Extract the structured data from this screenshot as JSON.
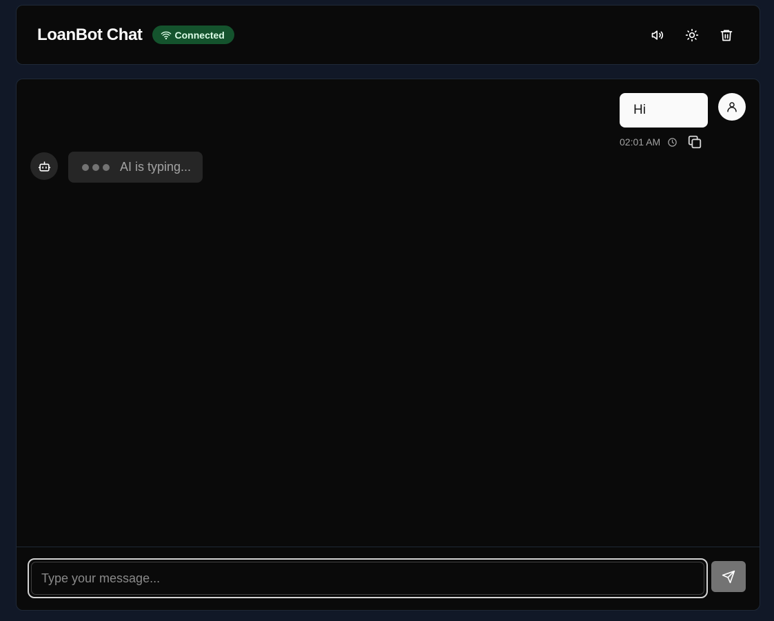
{
  "header": {
    "title": "LoanBot Chat",
    "status_label": "Connected",
    "status_icon": "wifi-icon",
    "actions": [
      {
        "name": "volume-button",
        "icon": "volume-icon"
      },
      {
        "name": "theme-toggle-button",
        "icon": "sun-icon"
      },
      {
        "name": "clear-chat-button",
        "icon": "trash-icon"
      }
    ]
  },
  "messages": [
    {
      "role": "user",
      "text": "Hi",
      "time": "02:01 AM"
    }
  ],
  "typing_indicator": {
    "label": "AI is typing..."
  },
  "composer": {
    "placeholder": "Type your message...",
    "value": "",
    "send_icon": "send-icon"
  },
  "colors": {
    "page_bg": "#111827",
    "panel_bg": "#0a0a0a",
    "status_badge_bg": "#14532d",
    "user_bubble_bg": "#fafafa",
    "bot_bubble_bg": "#262626",
    "send_button_bg": "#737373"
  }
}
